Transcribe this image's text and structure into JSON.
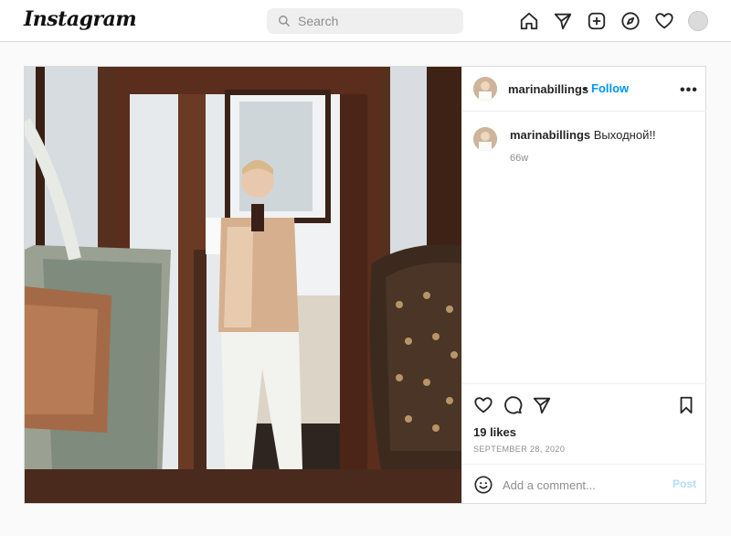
{
  "header": {
    "logo": "Instagram",
    "search_placeholder": "Search",
    "icons": [
      "home-icon",
      "direct-icon",
      "new-post-icon",
      "explore-icon",
      "activity-icon",
      "profile-avatar"
    ]
  },
  "post": {
    "username": "marinabillings",
    "follow_label": "Follow",
    "separator": "•",
    "more_label": "•••",
    "caption_username": "marinabillings",
    "caption_text": "Выходной!!",
    "caption_age": "66w",
    "likes": "19 likes",
    "date": "SEPTEMBER 28, 2020",
    "comment_placeholder": "Add a comment...",
    "post_button": "Post"
  },
  "colors": {
    "accent": "#0095f6",
    "post_disabled": "#b3dbff",
    "text": "#262626",
    "muted": "#8e8e8e"
  }
}
